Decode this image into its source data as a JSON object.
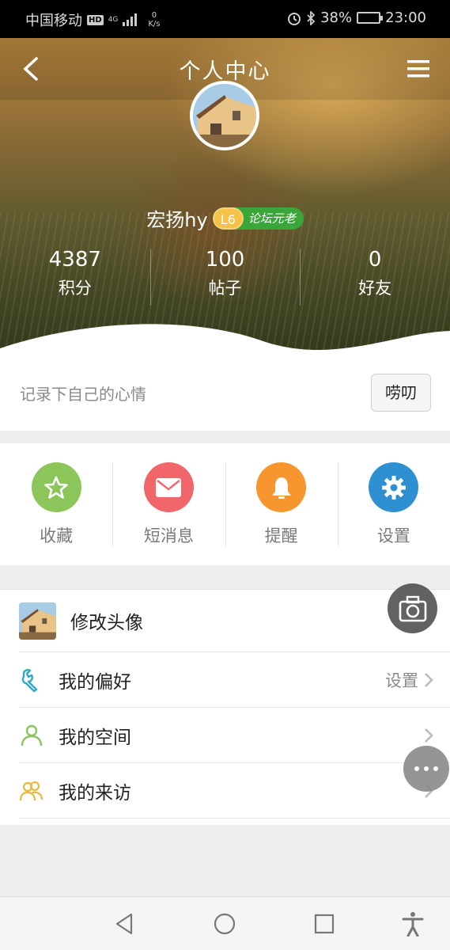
{
  "status_bar": {
    "carrier": "中国移动",
    "hd": "HD",
    "network": "4G",
    "speed_value": "0",
    "speed_unit": "K/s",
    "battery": "38%",
    "time": "23:00"
  },
  "header": {
    "title": "个人中心"
  },
  "profile": {
    "username": "宏扬hy",
    "level": "L6",
    "rank_title": "论坛元老"
  },
  "stats": [
    {
      "value": "4387",
      "label": "积分"
    },
    {
      "value": "100",
      "label": "帖子"
    },
    {
      "value": "0",
      "label": "好友"
    }
  ],
  "mood": {
    "placeholder": "记录下自己的心情",
    "button": "唠叨"
  },
  "quick_actions": [
    {
      "label": "收藏",
      "color": "#8cc65a",
      "icon": "star-icon"
    },
    {
      "label": "短消息",
      "color": "#f0666b",
      "icon": "envelope-icon"
    },
    {
      "label": "提醒",
      "color": "#f7962e",
      "icon": "bell-icon"
    },
    {
      "label": "设置",
      "color": "#2f90d1",
      "icon": "gear-icon"
    }
  ],
  "menu": [
    {
      "label": "修改头像",
      "right": ""
    },
    {
      "label": "我的偏好",
      "right": "设置"
    },
    {
      "label": "我的空间",
      "right": ""
    },
    {
      "label": "我的来访",
      "right": ""
    }
  ],
  "colors": {
    "accent_teal": "#2fa9c5",
    "accent_green": "#8cc65a",
    "accent_yellow": "#e8b93c"
  }
}
